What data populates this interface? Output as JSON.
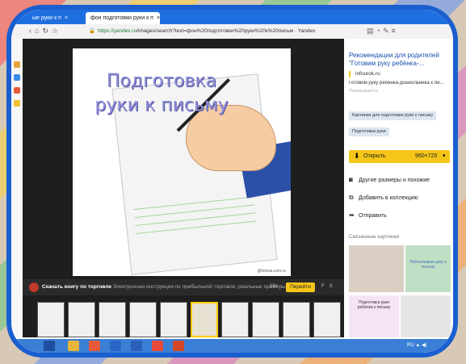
{
  "browser": {
    "tabs": [
      {
        "label": "ые руки к п",
        "close": "×"
      },
      {
        "label": "фон подготовки руки к п",
        "close": "×"
      }
    ],
    "new_tab": "+",
    "url_host": "https://yandex.ru",
    "url_path": "/images/search?text=фон%20подготовки%20руки%20к%20письм",
    "url_suffix": "Yandex"
  },
  "image": {
    "title_line1": "Подготовка",
    "title_line2": "руки к письму",
    "watermark": "@linksia.com.ru"
  },
  "ad": {
    "title": "Скачать книгу по торговле",
    "description": "Электронная инструкция по прибыльной торговле, реальные примеры професс...",
    "age": "18+",
    "button": "Перейти",
    "flag": "F",
    "close": "X"
  },
  "panel": {
    "title": "Рекомендации для родителей \"Готовим руку ребёнка-...",
    "site": "infourok.ru",
    "desc": "Готовим руку ребёнка-дошкольника к пи...",
    "show_more": "Показывается",
    "chips": [
      "Картинки для подготовки руки к письму",
      "Подготовка руки"
    ],
    "open_label": "Открыть",
    "open_size": "960×720",
    "actions": [
      "Другие размеры и похожие",
      "Добавить в коллекцию",
      "Отправить"
    ],
    "related_label": "Связанные картинки",
    "related_caption1": "Подготовка руки ребёнка к письму",
    "related_caption2": "Подготовим руку к письму"
  },
  "statusbar": {
    "zoom": "100%"
  },
  "taskbar": {
    "lang": "RU"
  },
  "colors": {
    "accent": "#f5c518",
    "frame": "#1a5fd0",
    "link": "#1a4fb0"
  }
}
